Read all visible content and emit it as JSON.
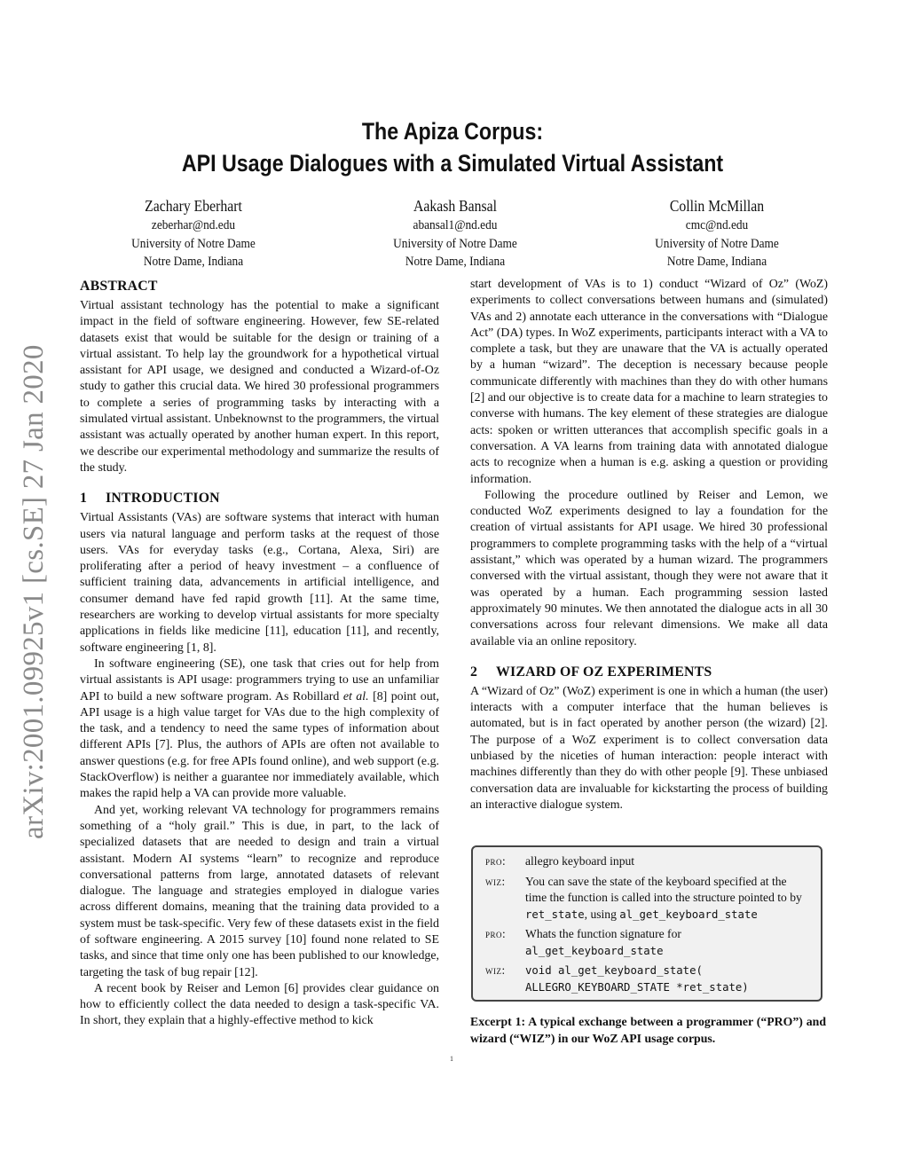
{
  "arxiv_stamp": "arXiv:2001.09925v1  [cs.SE]  27 Jan 2020",
  "title": {
    "line1": "The Apiza Corpus:",
    "line2": "API Usage Dialogues with a Simulated Virtual Assistant"
  },
  "authors": [
    {
      "name": "Zachary Eberhart",
      "email": "zeberhar@nd.edu",
      "affiliation": "University of Notre Dame",
      "location": "Notre Dame, Indiana"
    },
    {
      "name": "Aakash Bansal",
      "email": "abansal1@nd.edu",
      "affiliation": "University of Notre Dame",
      "location": "Notre Dame, Indiana"
    },
    {
      "name": "Collin McMillan",
      "email": "cmc@nd.edu",
      "affiliation": "University of Notre Dame",
      "location": "Notre Dame, Indiana"
    }
  ],
  "abstract": {
    "heading": "ABSTRACT",
    "text": "Virtual assistant technology has the potential to make a significant impact in the field of software engineering. However, few SE-related datasets exist that would be suitable for the design or training of a virtual assistant. To help lay the groundwork for a hypothetical virtual assistant for API usage, we designed and conducted a Wizard-of-Oz study to gather this crucial data. We hired 30 professional programmers to complete a series of programming tasks by interacting with a simulated virtual assistant. Unbeknownst to the programmers, the virtual assistant was actually operated by another human expert. In this report, we describe our experimental methodology and summarize the results of the study."
  },
  "section1": {
    "number": "1",
    "heading": "INTRODUCTION",
    "p1": "Virtual Assistants (VAs) are software systems that interact with human users via natural language and perform tasks at the request of those users. VAs for everyday tasks (e.g., Cortana, Alexa, Siri) are proliferating after a period of heavy investment – a confluence of sufficient training data, advancements in artificial intelligence, and consumer demand have fed rapid growth [11]. At the same time, researchers are working to develop virtual assistants for more specialty applications in fields like medicine [11], education [11], and recently, software engineering [1, 8].",
    "p2_before_em": "In software engineering (SE), one task that cries out for help from virtual assistants is API usage: programmers trying to use an unfamiliar API to build a new software program. As Robillard ",
    "p2_em": "et al.",
    "p2_after_em": " [8] point out, API usage is a high value target for VAs due to the high complexity of the task, and a tendency to need the same types of information about different APIs [7]. Plus, the authors of APIs are often not available to answer questions (e.g. for free APIs found online), and web support (e.g. StackOverflow) is neither a guarantee nor immediately available, which makes the rapid help a VA can provide more valuable.",
    "p3": "And yet, working relevant VA technology for programmers remains something of a “holy grail.” This is due, in part, to the lack of specialized datasets that are needed to design and train a virtual assistant. Modern AI systems “learn” to recognize and reproduce conversational patterns from large, annotated datasets of relevant dialogue. The language and strategies employed in dialogue varies across different domains, meaning that the training data provided to a system must be task-specific. Very few of these datasets exist in the field of software engineering. A 2015 survey [10] found none related to SE tasks, and since that time only one has been published to our knowledge, targeting the task of bug repair [12].",
    "p4": "A recent book by Reiser and Lemon [6] provides clear guidance on how to efficiently collect the data needed to design a task-specific VA. In short, they explain that a highly-effective method to kick",
    "p4_cont": "start development of VAs is to 1) conduct “Wizard of Oz” (WoZ) experiments to collect conversations between humans and (simulated) VAs and 2) annotate each utterance in the conversations with “Dialogue Act” (DA) types. In WoZ experiments, participants interact with a VA to complete a task, but they are unaware that the VA is actually operated by a human “wizard”. The deception is necessary because people communicate differently with machines than they do with other humans [2] and our objective is to create data for a machine to learn strategies to converse with humans. The key element of these strategies are dialogue acts: spoken or written utterances that accomplish specific goals in a conversation. A VA learns from training data with annotated dialogue acts to recognize when a human is e.g. asking a question or providing information.",
    "p5": "Following the procedure outlined by Reiser and Lemon, we conducted WoZ experiments designed to lay a foundation for the creation of virtual assistants for API usage. We hired 30 professional programmers to complete programming tasks with the help of a “virtual assistant,” which was operated by a human wizard. The programmers conversed with the virtual assistant, though they were not aware that it was operated by a human. Each programming session lasted approximately 90 minutes. We then annotated the dialogue acts in all 30 conversations across four relevant dimensions. We make all data available via an online repository."
  },
  "section2": {
    "number": "2",
    "heading": "WIZARD OF OZ EXPERIMENTS",
    "p1": "A “Wizard of Oz” (WoZ) experiment is one in which a human (the user) interacts with a computer interface that the human believes is automated, but is in fact operated by another person (the wizard) [2]. The purpose of a WoZ experiment is to collect conversation data unbiased by the niceties of human interaction: people interact with machines differently than they do with other people [9]. These unbiased conversation data are invaluable for kickstarting the process of building an interactive dialogue system."
  },
  "excerpt": {
    "rows": [
      {
        "speaker": "PRO:",
        "parts": [
          {
            "t": "allegro keyboard input",
            "mono": false
          }
        ]
      },
      {
        "speaker": "WIZ:",
        "parts": [
          {
            "t": "You can save the state of the keyboard specified at the time the function is called into the structure pointed to by ",
            "mono": false
          },
          {
            "t": "ret_state",
            "mono": true
          },
          {
            "t": ", using ",
            "mono": false
          },
          {
            "t": "al_get_keyboard_state",
            "mono": true
          }
        ]
      },
      {
        "speaker": "PRO:",
        "parts": [
          {
            "t": "Whats the function signature for ",
            "mono": false
          },
          {
            "t": "al_get_keyboard_state",
            "mono": true
          }
        ]
      },
      {
        "speaker": "WIZ:",
        "parts": [
          {
            "t": "void al_get_keyboard_state(",
            "mono": true
          },
          {
            "t": "ALLEGRO_KEYBOARD_STATE *ret_state)",
            "mono": true
          }
        ]
      }
    ],
    "caption": "Excerpt 1: A typical exchange between a programmer (“PRO”) and wizard (“WIZ”) in our WoZ API usage corpus."
  },
  "page_number": "1"
}
